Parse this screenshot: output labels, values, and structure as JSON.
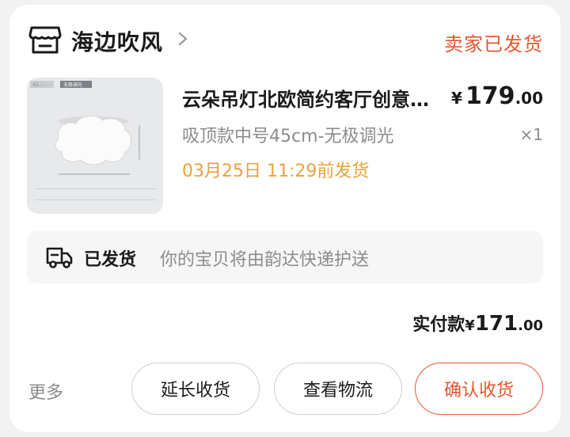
{
  "shop": {
    "name": "海边吹风",
    "icon": "store-icon"
  },
  "order_status": "卖家已发货",
  "product": {
    "title": "云朵吊灯北欧简约客厅创意卧室灯",
    "sku": "吸顶款中号45cm-无极调光",
    "price_symbol": "¥",
    "price_int": "179",
    "price_dec": ".00",
    "quantity": "×1",
    "ship_time": "03月25日 11:29前发货",
    "image_tags": [
      "45...",
      "无极调光"
    ]
  },
  "logistics": {
    "icon": "truck-icon",
    "status": "已发货",
    "detail": "你的宝贝将由韵达快递护送"
  },
  "payment": {
    "label": "实付款",
    "symbol": "¥",
    "int": "171",
    "dec": ".00"
  },
  "actions": {
    "more": "更多",
    "extend": "延长收货",
    "view_logistics": "查看物流",
    "confirm": "确认收货"
  },
  "colors": {
    "accent": "#e4572e",
    "ship_time": "#e8a33d",
    "muted": "#8c8c8c"
  }
}
